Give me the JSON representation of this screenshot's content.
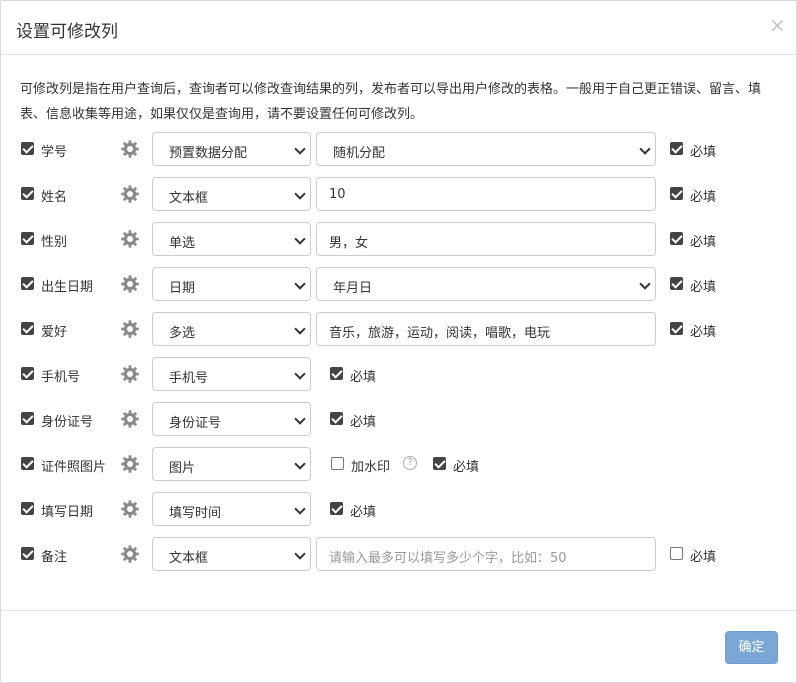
{
  "modal": {
    "title": "设置可修改列",
    "close": "×",
    "description": "可修改列是指在用户查询后，查询者可以修改查询结果的列，发布者可以导出用户修改的表格。一般用于自己更正错误、留言、填表、信息收集等用途，如果仅仅是查询用，请不要设置任何可修改列。",
    "ok_label": "确定"
  },
  "rows": [
    {
      "label": "学号",
      "checked": true,
      "type": "预置数据分配",
      "value": "随机分配",
      "value_kind": "select",
      "required_label": "必填",
      "required": true
    },
    {
      "label": "姓名",
      "checked": true,
      "type": "文本框",
      "value": "10",
      "value_kind": "input",
      "required_label": "必填",
      "required": true
    },
    {
      "label": "性别",
      "checked": true,
      "type": "单选",
      "value": "男，女",
      "value_kind": "input",
      "required_label": "必填",
      "required": true
    },
    {
      "label": "出生日期",
      "checked": true,
      "type": "日期",
      "value": "年月日",
      "value_kind": "select",
      "required_label": "必填",
      "required": true
    },
    {
      "label": "爱好",
      "checked": true,
      "type": "多选",
      "value": "音乐，旅游，运动，阅读，唱歌，电玩",
      "value_kind": "input",
      "required_label": "必填",
      "required": true
    },
    {
      "label": "手机号",
      "checked": true,
      "type": "手机号",
      "value_kind": "none",
      "required_label": "必填",
      "required": true
    },
    {
      "label": "身份证号",
      "checked": true,
      "type": "身份证号",
      "value_kind": "none",
      "required_label": "必填",
      "required": true
    },
    {
      "label": "证件照图片",
      "checked": true,
      "type": "图片",
      "value_kind": "watermark",
      "watermark_label": "加水印",
      "watermark": false,
      "help": "?",
      "required_label": "必填",
      "required": true
    },
    {
      "label": "填写日期",
      "checked": true,
      "type": "填写时间",
      "value_kind": "none",
      "required_label": "必填",
      "required": true
    },
    {
      "label": "备注",
      "checked": true,
      "type": "文本框",
      "placeholder": "请输入最多可以填写多少个字，比如：50",
      "value_kind": "placeholder",
      "required_label": "必填",
      "required": false
    }
  ]
}
